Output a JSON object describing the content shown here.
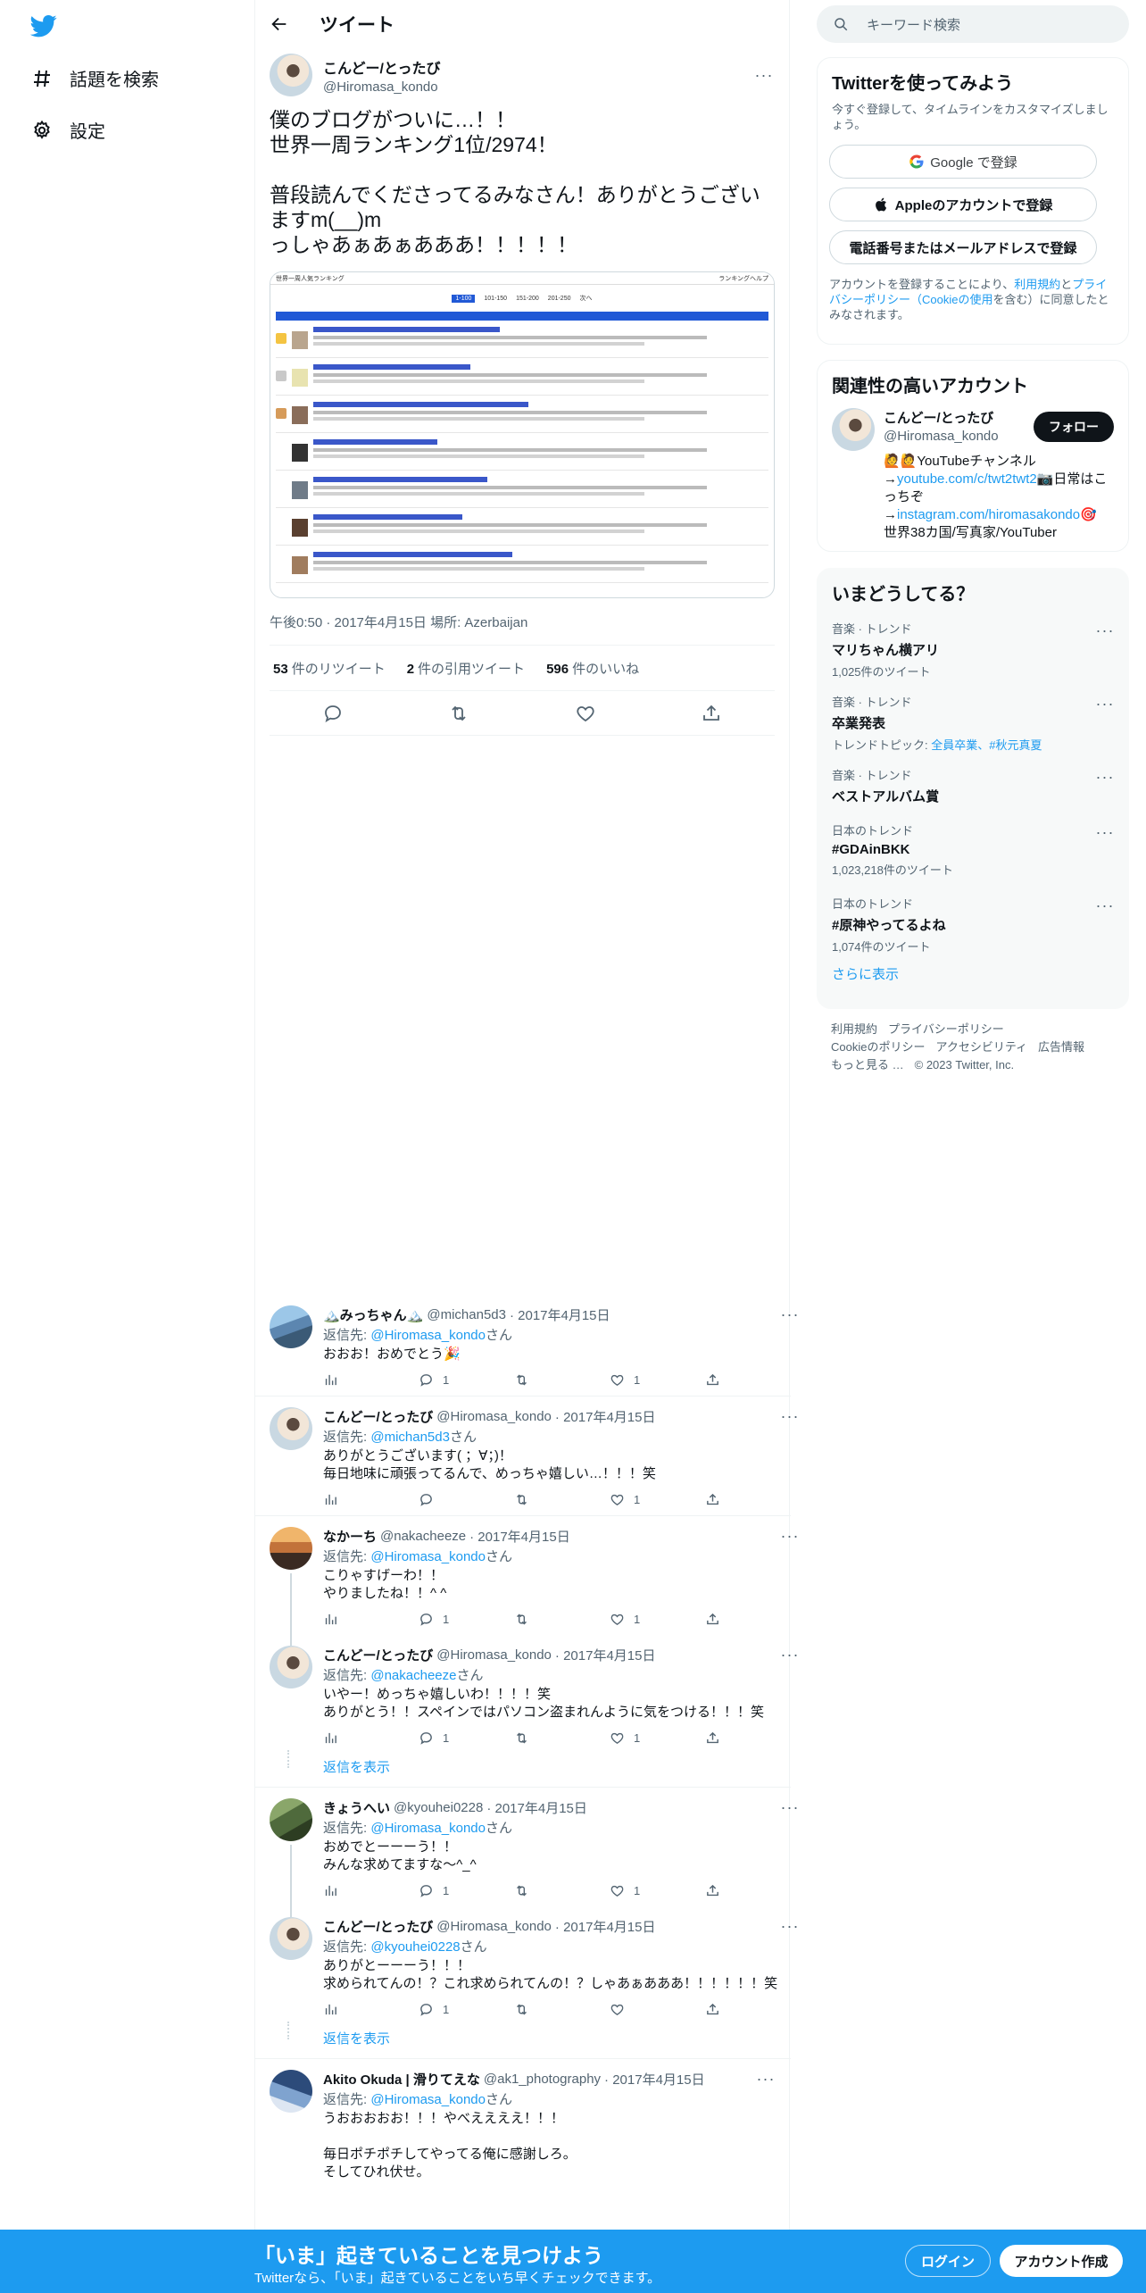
{
  "nav": {
    "explore_label": "話題を検索",
    "settings_label": "設定"
  },
  "header": {
    "title": "ツイート"
  },
  "tweet": {
    "display_name": "こんどー/とったび",
    "username": "@Hiromasa_kondo",
    "text": "僕のブログがついに…！！\n世界一周ランキング1位/2974！\n\n普段読んでくださってるみなさん！ありがとうございますm(__)m\nっしゃあぁあぁあああ！！！！！",
    "meta": "午後0:50 · 2017年4月15日 場所: Azerbaijan",
    "retweets_count": "53",
    "retweets_label": "件のリツイート",
    "quotes_count": "2",
    "quotes_label": "件の引用ツイート",
    "likes_count": "596",
    "likes_label": "件のいいね"
  },
  "replies": [
    {
      "display_name": "🏔️みっちゃん🏔️",
      "username": "@michan5d3",
      "date": "· 2017年4月15日",
      "reply_to_label": "返信先:",
      "reply_to": "@Hiromasa_kondo",
      "reply_to_suffix": "さん",
      "text": "おおお！おめでとう🎉",
      "replies": "1",
      "likes": "1"
    },
    {
      "display_name": "こんどー/とったび",
      "username": "@Hiromasa_kondo",
      "date": "· 2017年4月15日",
      "reply_to_label": "返信先:",
      "reply_to": "@michan5d3",
      "reply_to_suffix": "さん",
      "text": "ありがとうございます( ；∀；)！\n毎日地味に頑張ってるんで、めっちゃ嬉しい…！！！笑",
      "replies": "",
      "likes": "1"
    },
    {
      "display_name": "なかーち",
      "username": "@nakacheeze",
      "date": "· 2017年4月15日",
      "reply_to_label": "返信先:",
      "reply_to": "@Hiromasa_kondo",
      "reply_to_suffix": "さん",
      "text": "こりゃすげーわ！！\nやりましたね！！^ ^",
      "replies": "1",
      "likes": "1"
    },
    {
      "display_name": "こんどー/とったび",
      "username": "@Hiromasa_kondo",
      "date": "· 2017年4月15日",
      "reply_to_label": "返信先:",
      "reply_to": "@nakacheeze",
      "reply_to_suffix": "さん",
      "text": "いやー！めっちゃ嬉しいわ！！！！笑\nありがとう！！スペインではパソコン盗まれんように気をつける！！！笑",
      "replies": "1",
      "likes": "1"
    },
    {
      "display_name": "きょうへい",
      "username": "@kyouhei0228",
      "date": "· 2017年4月15日",
      "reply_to_label": "返信先:",
      "reply_to": "@Hiromasa_kondo",
      "reply_to_suffix": "さん",
      "text": "おめでとーーーう！！\nみんな求めてますな〜^_^",
      "replies": "1",
      "likes": "1"
    },
    {
      "display_name": "こんどー/とったび",
      "username": "@Hiromasa_kondo",
      "date": "· 2017年4月15日",
      "reply_to_label": "返信先:",
      "reply_to": "@kyouhei0228",
      "reply_to_suffix": "さん",
      "text": "ありがとーーーう！！！\n求められてんの！？これ求められてんの！？しゃあぁあああ！！！！！！笑",
      "replies": "1",
      "likes": ""
    },
    {
      "display_name": "Akito Okuda | 滑りてえな",
      "username": "@ak1_photography",
      "date": "· 2017年4月15日",
      "reply_to_label": "返信先:",
      "reply_to": "@Hiromasa_kondo",
      "reply_to_suffix": "さん",
      "text": "うおおおおお！！！やべええええ！！！\n\n毎日ポチポチしてやってる俺に感謝しろ。\nそしてひれ伏せ。",
      "replies": "",
      "likes": ""
    }
  ],
  "show_replies_label": "返信を表示",
  "search": {
    "placeholder": "キーワード検索"
  },
  "signup": {
    "title": "Twitterを使ってみよう",
    "subtitle": "今すぐ登録して、タイムラインをカスタマイズしましょう。",
    "google": "Google で登録",
    "apple": "Appleのアカウントで登録",
    "phone": "電話番号またはメールアドレスで登録",
    "terms_prefix": "アカウントを登録することにより、",
    "terms_link": "利用規約",
    "terms_mid": "と",
    "privacy_link": "プライバシーポリシー（Cookieの使用",
    "terms_suffix": "を含む）に同意したとみなされます。"
  },
  "related": {
    "title": "関連性の高いアカウント",
    "display_name": "こんどー/とったび",
    "username": "@Hiromasa_kondo",
    "follow": "フォロー",
    "bio_1": "🙋🙋YouTubeチャンネル\n→",
    "bio_link1": "youtube.com/c/twt2twt2",
    "bio_2": "📷日常はこっちぞ\n→",
    "bio_link2": "instagram.com/hiromasakondo",
    "bio_3": "🎯\n世界38カ国/写真家/YouTuber"
  },
  "trends": {
    "title": "いまどうしてる？",
    "items": [
      {
        "context": "音楽 · トレンド",
        "name": "マリちゃん横アリ",
        "count": "1,025件のツイート"
      },
      {
        "context": "音楽 · トレンド",
        "name": "卒業発表",
        "count_prefix": "トレンドトピック: ",
        "count_link": "全員卒業、#秋元真夏"
      },
      {
        "context": "音楽 · トレンド",
        "name": "ベストアルバム賞"
      },
      {
        "context": "日本のトレンド",
        "name": "#GDAinBKK",
        "count": "1,023,218件のツイート"
      },
      {
        "context": "日本のトレンド",
        "name": "#原神やってるよね",
        "count": "1,074件のツイート"
      }
    ],
    "show_more": "さらに表示"
  },
  "footer": {
    "terms": "利用規約",
    "privacy": "プライバシーポリシー",
    "cookie": "Cookieのポリシー",
    "accessibility": "アクセシビリティ",
    "ads": "広告情報",
    "more": "もっと見る …",
    "copyright": "© 2023 Twitter, Inc."
  },
  "bottom": {
    "headline": "「いま」起きていることを見つけよう",
    "sub": "Twitterなら、「いま」起きていることをいち早くチェックできます。",
    "login": "ログイン",
    "create": "アカウント作成"
  },
  "image_mock": {
    "header_left": "世界一周人気ランキング",
    "header_right": "ランキングヘルプ",
    "tab_1": "1-100",
    "tab_2": "101-150",
    "tab_3": "151-200",
    "tab_4": "201-250",
    "tab_5": "次へ"
  },
  "colors": {
    "accent": "#1d9bf0",
    "text": "#0f1419",
    "muted": "#536471"
  }
}
